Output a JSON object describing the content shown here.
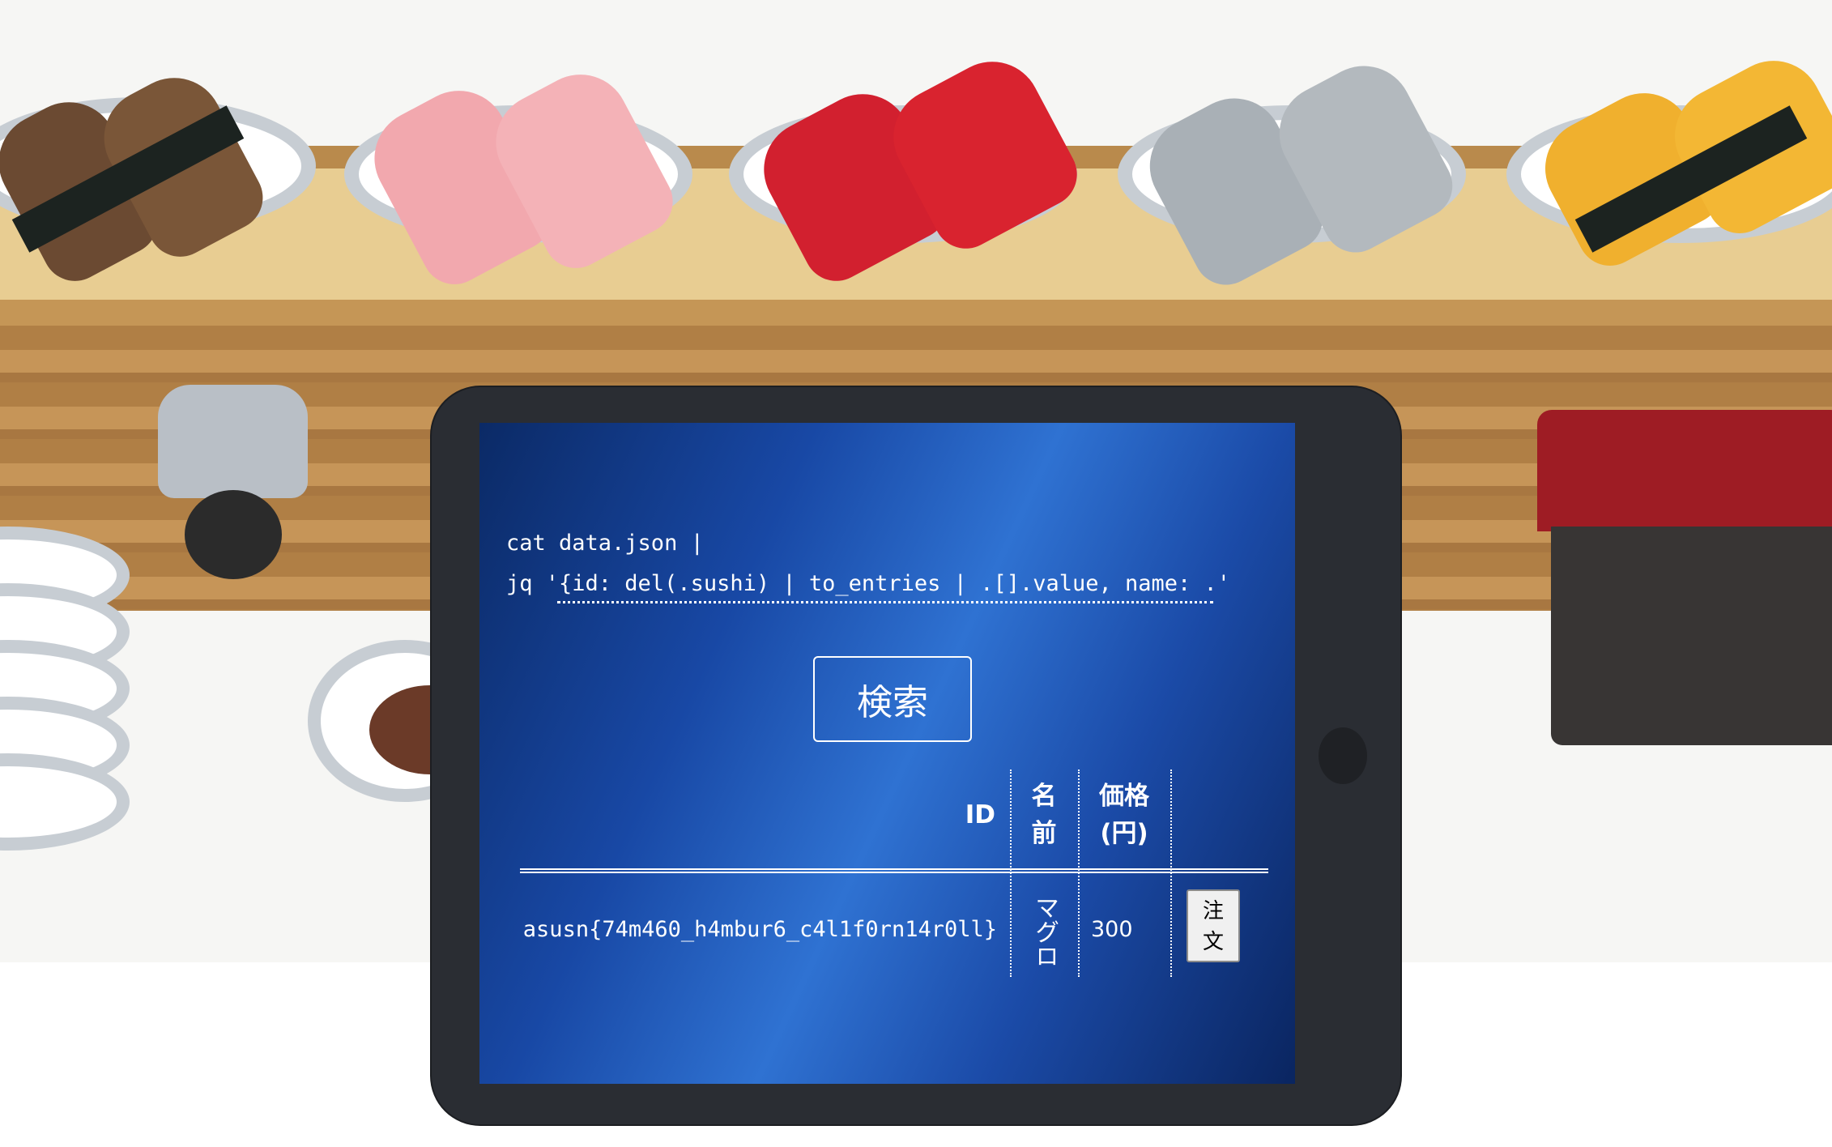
{
  "screen": {
    "command_line1": "cat data.json |",
    "command_line2": "jq '{id: del(.sushi) | to_entries | .[].value, name: .'",
    "search_button": "検索",
    "table": {
      "headers": {
        "id": "ID",
        "name": "名前",
        "price": "価格(円)"
      },
      "rows": [
        {
          "id": "asusn{74m460_h4mbur6_c4l1f0rn14r0ll}",
          "name": "マグロ",
          "price": "300",
          "order_label": "注文"
        }
      ]
    }
  },
  "colors": {
    "screen_gradient": [
      "#0b2a66",
      "#2f72d2",
      "#0a2560"
    ],
    "tablet_frame": "#2a2d33",
    "text": "#ffffff"
  },
  "icons": {
    "background": "sushi-conveyor-illustration"
  }
}
